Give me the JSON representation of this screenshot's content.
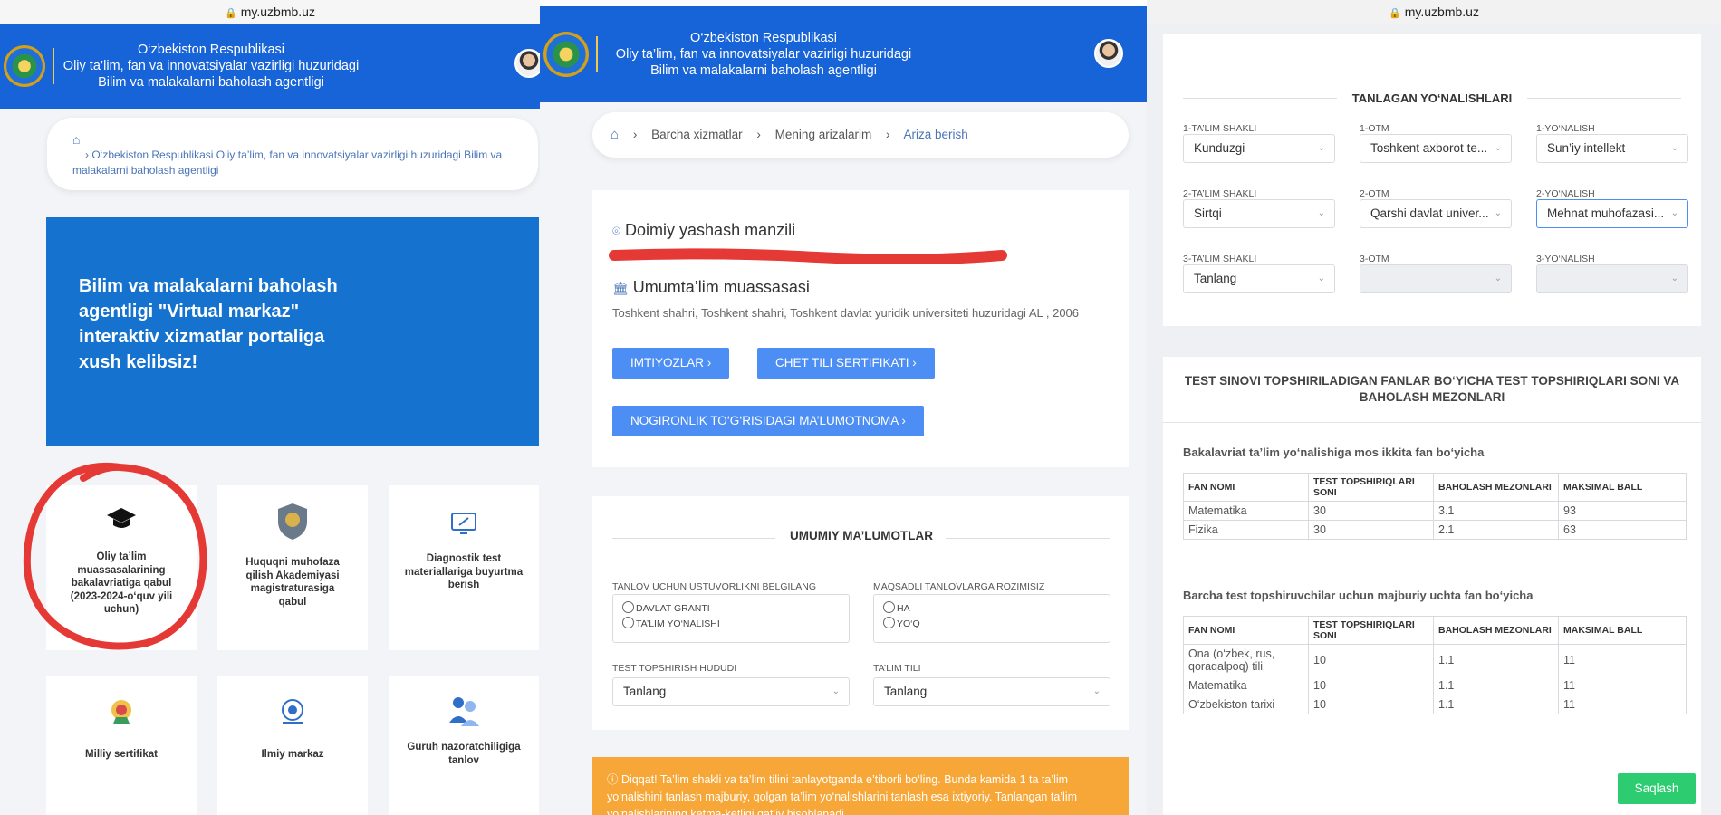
{
  "browser": {
    "url": "my.uzbmb.uz"
  },
  "header": {
    "line1": "O‘zbekiston Respublikasi",
    "line2": "Oliy ta’lim, fan va innovatsiyalar vazirligi huzuridagi",
    "line3": "Bilim va malakalarni baholash agentligi"
  },
  "panel1": {
    "breadcrumb": "O‘zbekiston Respublikasi Oliy ta’lim, fan va innovatsiyalar vazirligi huzuridagi Bilim va malakalarni baholash agentligi",
    "hero": "Bilim va malakalarni baholash agentligi \"Virtual markaz\" interaktiv xizmatlar portaliga xush kelibsiz!",
    "tiles": [
      {
        "label": "Oliy ta’lim muassasalarining bakalavriatiga qabul (2023-2024-o‘quv yili uchun)",
        "icon": "graduation-cap-icon"
      },
      {
        "label": "Huquqni muhofaza qilish Akademiyasi magistraturasiga qabul",
        "icon": "shield-emblem-icon"
      },
      {
        "label": "Diagnostik test materiallariga buyurtma berish",
        "icon": "monitor-icon"
      },
      {
        "label": "Milliy sertifikat",
        "icon": "certificate-icon"
      },
      {
        "label": "Ilmiy markaz",
        "icon": "science-icon"
      },
      {
        "label": "Guruh nazoratchiligiga tanlov",
        "icon": "group-icon"
      }
    ]
  },
  "panel2": {
    "breadcrumb": {
      "item1": "Barcha xizmatlar",
      "item2": "Mening arizalarim",
      "item3": "Ariza berish"
    },
    "address_title": "Doimiy yashash manzili",
    "school_title": "Umumta’lim muassasasi",
    "school_value": "Toshkent shahri, Toshkent shahri, Toshkent davlat yuridik universiteti huzuridagi AL , 2006",
    "buttons": {
      "privileges": "IMTIYOZLAR",
      "cert": "CHET TILI SERTIFIKATI",
      "disability": "NOGIRONLIK TO‘G‘RISIDAGI MA’LUMOTNOMA"
    },
    "general_title": "UMUMIY MA’LUMOTLAR",
    "priority_label": "TANLOV UCHUN USTUVORLIKNI BELGILANG",
    "priority_opt1": "DAVLAT GRANTI",
    "priority_opt2": "TA’LIM YO‘NALISHI",
    "targeted_label": "MAQSADLI TANLOVLARGA ROZIMISIZ",
    "targeted_opt1": "HA",
    "targeted_opt2": "YO‘Q",
    "region_label": "TEST TOPSHIRISH HUDUDI",
    "region_value": "Tanlang",
    "lang_label": "TA’LIM TILI",
    "lang_value": "Tanlang",
    "warning": "Diqqat! Ta’lim shakli va ta’lim tilini tanlayotganda e’tiborli bo‘ling. Bunda kamida 1 ta ta’lim yo‘nalishini tanlash majburiy, qolgan ta’lim yo‘nalishlarini tanlash esa ixtiyoriy. Tanlangan ta’lim yo‘nalishlarining ketma-ketligi qat’iy hisoblanadi."
  },
  "panel3": {
    "chosen_title": "TANLAGAN YO‘NALISHLARI",
    "rows": [
      {
        "form_label": "1-TA’LIM SHAKLI",
        "form": "Kunduzgi",
        "otm_label": "1-OTM",
        "otm": "Toshkent axborot te...",
        "dir_label": "1-YO‘NALISH",
        "dir": "Sun’iy intellekt"
      },
      {
        "form_label": "2-TA’LIM SHAKLI",
        "form": "Sirtqi",
        "otm_label": "2-OTM",
        "otm": "Qarshi davlat univer...",
        "dir_label": "2-YO‘NALISH",
        "dir": "Mehnat muhofazasi..."
      },
      {
        "form_label": "3-TA’LIM SHAKLI",
        "form": "Tanlang",
        "otm_label": "3-OTM",
        "otm": "",
        "dir_label": "3-YO‘NALISH",
        "dir": ""
      }
    ],
    "tests_title": "TEST SINOVI TOPSHIRILADIGAN FANLAR BO‘YICHA TEST TOPSHIRIQLARI SONI VA BAHOLASH MEZONLARI",
    "t1_caption": "Bakalavriat ta’lim yo‘nalishiga mos ikkita fan bo‘yicha",
    "t2_caption": "Barcha test topshiruvchilar uchun majburiy uchta fan bo‘yicha",
    "headers": {
      "h1": "FAN NOMI",
      "h2": "TEST TOPSHIRIQLARI SONI",
      "h3": "BAHOLASH MEZONLARI",
      "h4": "MAKSIMAL BALL"
    },
    "table1": [
      [
        "Matematika",
        "30",
        "3.1",
        "93"
      ],
      [
        "Fizika",
        "30",
        "2.1",
        "63"
      ]
    ],
    "table2": [
      [
        "Ona (o‘zbek, rus, qoraqalpoq) tili",
        "10",
        "1.1",
        "11"
      ],
      [
        "Matematika",
        "10",
        "1.1",
        "11"
      ],
      [
        "O‘zbekiston tarixi",
        "10",
        "1.1",
        "11"
      ]
    ],
    "save": "Saqlash"
  },
  "colors": {
    "header": "#1763d8",
    "hero": "#1572cf",
    "button": "#4d8ef4",
    "warning": "#f7a738",
    "save": "#2ecc71",
    "annotation": "#e53935"
  }
}
